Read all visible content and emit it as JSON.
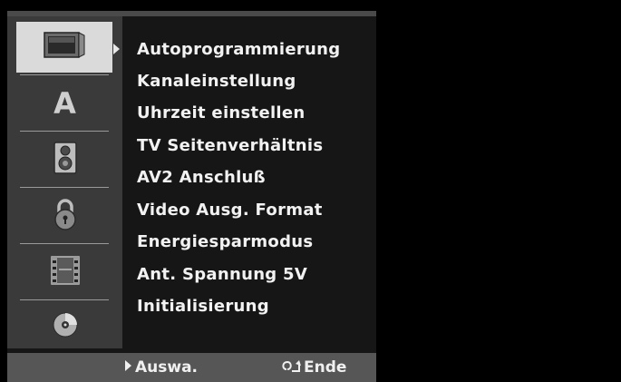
{
  "sidebar": {
    "icons": [
      {
        "name": "tv-icon",
        "selected": true
      },
      {
        "name": "language-icon",
        "glyph": "A",
        "selected": false
      },
      {
        "name": "speaker-icon",
        "selected": false
      },
      {
        "name": "lock-icon",
        "selected": false
      },
      {
        "name": "film-icon",
        "selected": false
      },
      {
        "name": "disc-icon",
        "selected": false
      }
    ]
  },
  "menu": {
    "items": [
      "Autoprogrammierung",
      "Kanaleinstellung",
      "Uhrzeit einstellen",
      "TV Seitenverhältnis",
      "AV2 Anschluß",
      "Video Ausg. Format",
      "Energiesparmodus",
      "Ant. Spannung 5V",
      "Initialisierung"
    ]
  },
  "footer": {
    "select_label": "Auswa.",
    "exit_label": "Ende"
  },
  "colors": {
    "background": "#000000",
    "panel": "#161616",
    "sidebar": "#3a3a3a",
    "selected_cell": "#dadada",
    "footer": "#565656",
    "text": "#f2f2f2"
  }
}
